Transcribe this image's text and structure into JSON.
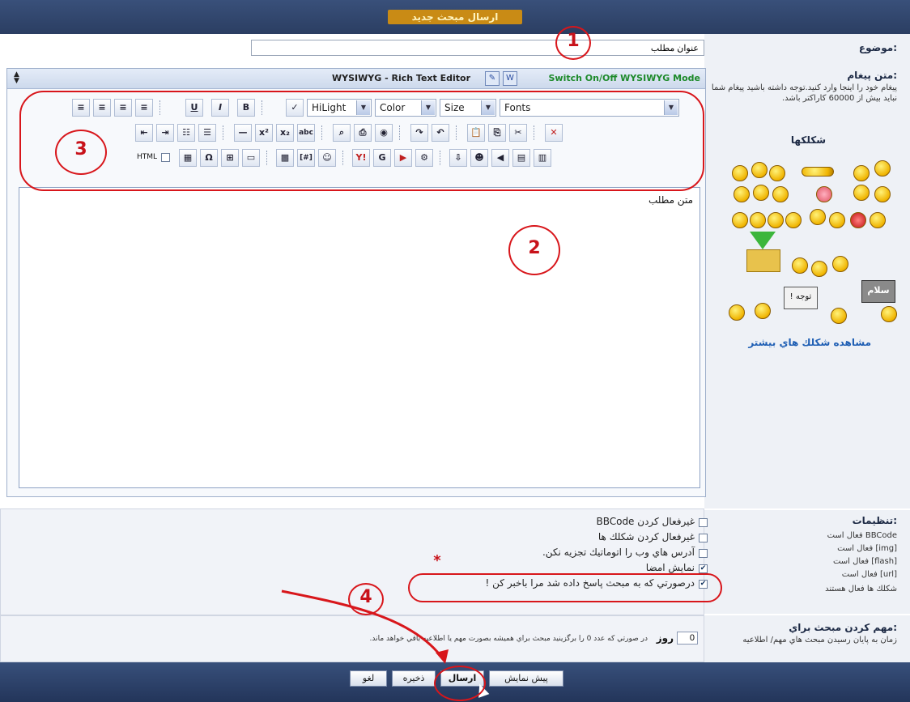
{
  "header": {
    "title": "ارسال مبحث جديد"
  },
  "subject": {
    "label": "موضوع:",
    "value": "عنوان مطلب"
  },
  "message": {
    "label": "متن پيغام:",
    "note": "پيغام خود را اينجا وارد كنيد.توجه داشته باشيد پيغام شما نبايد بيش از 60000 كاراكتر باشد."
  },
  "smilies": {
    "title": "شكلكها",
    "more_link": "مشاهده شكلك هاي بيشتر",
    "sign1": "توجه !",
    "sign2": "سلام"
  },
  "editor": {
    "title": "WYSIWYG - Rich Text Editor",
    "switch_label": "Switch On/Off WYSIWYG Mode",
    "content": "متن مطلب",
    "html_label": "HTML",
    "dropdowns": {
      "hilight": "HiLight",
      "color": "Color",
      "size": "Size",
      "fonts": "Fonts"
    }
  },
  "annotations": {
    "one": "1",
    "two": "2",
    "three": "3",
    "four": "4",
    "star": "*"
  },
  "settings": {
    "label": "تنظيمات:",
    "options": [
      {
        "text": "غيرفعال كردن BBCode",
        "checked": false
      },
      {
        "text": "غيرفعال كردن شكلك ها",
        "checked": false
      },
      {
        "text": "آدرس هاي وب را اتوماتيك تجزيه نكن.",
        "checked": false
      },
      {
        "text": "نمايش امضا",
        "checked": true
      },
      {
        "text": "درصورتي كه به مبحث پاسخ داده شد مرا باخبر كن !",
        "checked": true
      }
    ],
    "side": [
      "BBCode فعال است",
      "[img] فعال است",
      "[flash] فعال است",
      "[url] فعال است",
      "شكلك ها فعال هستند"
    ]
  },
  "sticky": {
    "label": "مهم كردن مبحث براي:",
    "note": "زمان به پايان رسيدن مبحث هاي مهم/ اطلاعيه",
    "days_value": "0",
    "days_unit": "روز",
    "days_note": "در صورتي كه عدد 0 را برگزينيد مبحث براي هميشه بصورت مهم يا اطلاعيه باقي خواهد ماند."
  },
  "buttons": {
    "preview": "پيش نمايش",
    "submit": "ارسال",
    "save": "ذخيره",
    "cancel": "لغو"
  },
  "colors": {
    "accent": "#d8161b",
    "bar": "#2b3e62",
    "link": "#1f5fb4"
  }
}
